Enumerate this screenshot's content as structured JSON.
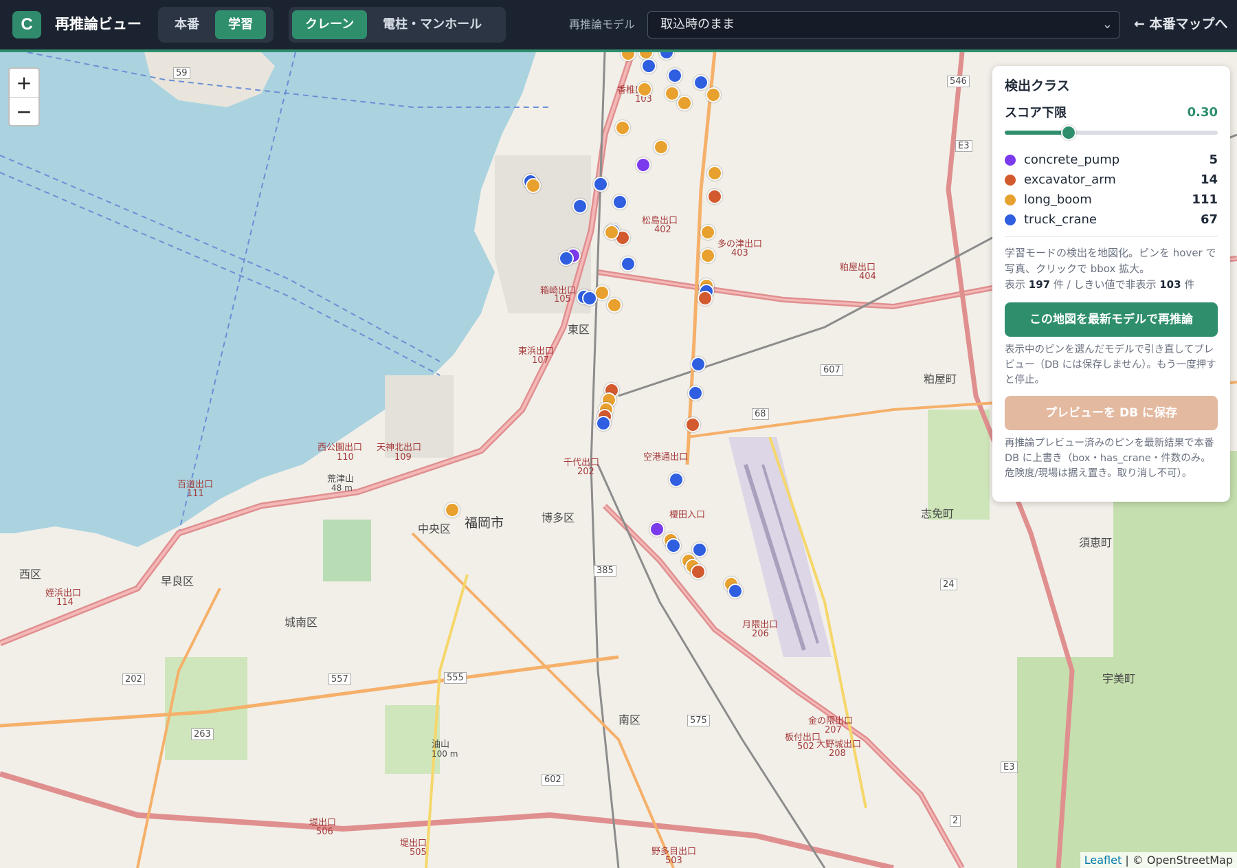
{
  "header": {
    "logo_letter": "C",
    "title": "再推論ビュー",
    "mode_tabs": [
      {
        "label": "本番",
        "active": false
      },
      {
        "label": "学習",
        "active": true
      }
    ],
    "target_tabs": [
      {
        "label": "クレーン",
        "active": true
      },
      {
        "label": "電柱・マンホール",
        "active": false
      }
    ],
    "model_label": "再推論モデル",
    "model_value": "取込時のまま",
    "back_link": "← 本番マップへ"
  },
  "map": {
    "zoom_in": "+",
    "zoom_out": "−",
    "attribution_leaflet": "Leaflet",
    "attribution_rest": " | © OpenStreetMap",
    "labels": {
      "fukuoka": "福岡市",
      "chuo": "中央区",
      "hakata": "博多区",
      "higashi": "東区",
      "nishi": "西区",
      "sawara": "早良区",
      "jonan": "城南区",
      "minami": "南区",
      "kasuya": "粕屋町",
      "shime": "志免町",
      "sue": "須恵町",
      "umi": "宇美町",
      "arasu": "荒津山",
      "arasu_h": "48 m",
      "aburayama": "油山",
      "aburayama_h": "100 m"
    },
    "road_labels": {
      "hakozaki": "箱崎出口",
      "hakozaki_no": "105",
      "higashihama": "東浜出口",
      "higashihama_no": "107",
      "chiyo": "千代出口",
      "chiyo_no": "202",
      "nishikoen": "西公園出口",
      "nishikoen_no": "110",
      "tenjin": "天神北出口",
      "tenjin_no": "109",
      "hyakudo": "百道出口",
      "hyakudo_no": "111",
      "meinohama": "姪浜出口",
      "meinohama_no": "114",
      "tsutsumi1": "堤出口",
      "tsutsumi1_no": "506",
      "tsutsumi2": "堤出口",
      "tsutsumi2_no": "505",
      "nokata": "野多目出口",
      "nokata_no": "503",
      "gekkuma": "月隈出口",
      "gekkuma_no": "206",
      "kanenokuma": "金の隈出口",
      "kanenokuma_no": "207",
      "oonojo": "大野城出口",
      "oonojo_no": "208",
      "itazuke": "板付出口",
      "itazuke_no": "502",
      "matsushima": "松島出口",
      "matsushima_no": "402",
      "tatara": "多の津出口",
      "tatara_no": "403",
      "kasuya_in": "粕屋出口",
      "kasuya_in_no": "404",
      "kashii": "香椎出口",
      "kashii_no": "103",
      "kuko": "空港通出口",
      "enokida": "榎田入口",
      "r59": "59",
      "r546": "546",
      "r607": "607",
      "r68": "68",
      "r385": "385",
      "r202": "202",
      "r557": "557",
      "r555": "555",
      "r263": "263",
      "r575": "575",
      "r602": "602",
      "r24": "24",
      "r2": "2",
      "e3a": "E3",
      "e3b": "E3"
    }
  },
  "panel": {
    "title": "検出クラス",
    "score_label": "スコア下限",
    "score_value": "0.30",
    "score_fraction": 0.3,
    "classes": [
      {
        "name": "concrete_pump",
        "count": "5",
        "color": "#7c3aed"
      },
      {
        "name": "excavator_arm",
        "count": "14",
        "color": "#d35a2e"
      },
      {
        "name": "long_boom",
        "count": "111",
        "color": "#e8a12e"
      },
      {
        "name": "truck_crane",
        "count": "67",
        "color": "#2f5fe0"
      }
    ],
    "desc_line1": "学習モードの検出を地図化。ピンを hover で写真、クリックで bbox 拡大。",
    "desc_shown_prefix": "表示 ",
    "desc_shown": "197",
    "desc_shown_mid": " 件 / しきい値で非表示 ",
    "desc_hidden": "103",
    "desc_hidden_suffix": " 件",
    "btn_rerun": "この地図を最新モデルで再推論",
    "rerun_note": "表示中のピンを選んだモデルで引き直してプレビュー（DB には保存しません）。もう一度押すと停止。",
    "btn_save": "プレビューを DB に保存",
    "save_note": "再推論プレビュー済みのピンを最新結果で本番 DB に上書き（box・has_crane・件数のみ。危険度/現場は据え置き。取り消し不可）。"
  }
}
